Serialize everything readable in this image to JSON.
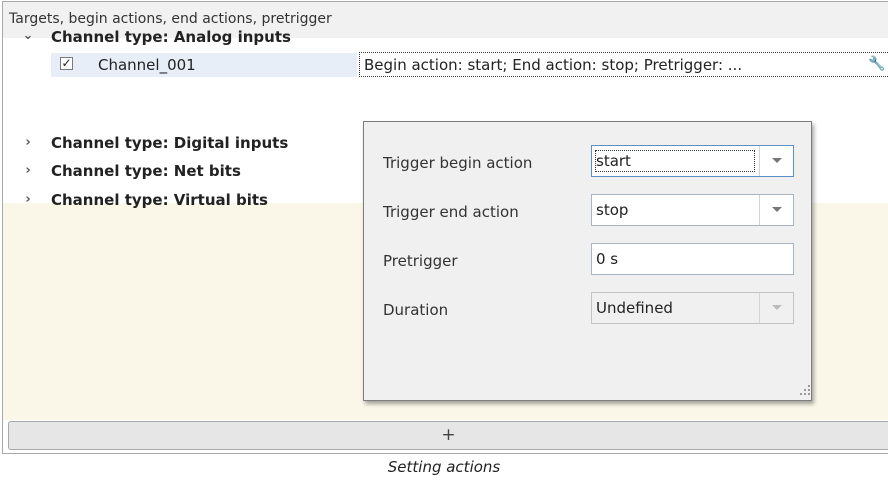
{
  "panel": {
    "header_title": "Targets, begin actions, end actions, pretrigger"
  },
  "tree": {
    "expanded_icon": "chevron-down-icon",
    "collapsed_icon": "chevron-right-icon",
    "groups": [
      {
        "label": "Channel type: Analog inputs",
        "expanded": true
      },
      {
        "label": "Channel type: Digital inputs",
        "expanded": false
      },
      {
        "label": "Channel type: Net bits",
        "expanded": false
      },
      {
        "label": "Channel type: Virtual bits",
        "expanded": false
      }
    ],
    "channel": {
      "checked": true,
      "label": "Channel_001",
      "summary": "Begin action: start; End action: stop; Pretrigger: ...",
      "edit_icon": "wrench-icon"
    }
  },
  "popup": {
    "fields": [
      {
        "label": "Trigger begin action",
        "value": "start",
        "type": "dropdown"
      },
      {
        "label": "Trigger end action",
        "value": "stop",
        "type": "dropdown"
      },
      {
        "label": "Pretrigger",
        "value": "0 s",
        "type": "text"
      },
      {
        "label": "Duration",
        "value": "Undefined",
        "type": "dropdown",
        "disabled": true
      }
    ]
  },
  "footer": {
    "add_label": "+"
  },
  "caption": "Setting actions",
  "colors": {
    "selection_row": "#e7eef8",
    "empty_area": "#faf7e8",
    "popup_bg": "#f0f0f0"
  }
}
